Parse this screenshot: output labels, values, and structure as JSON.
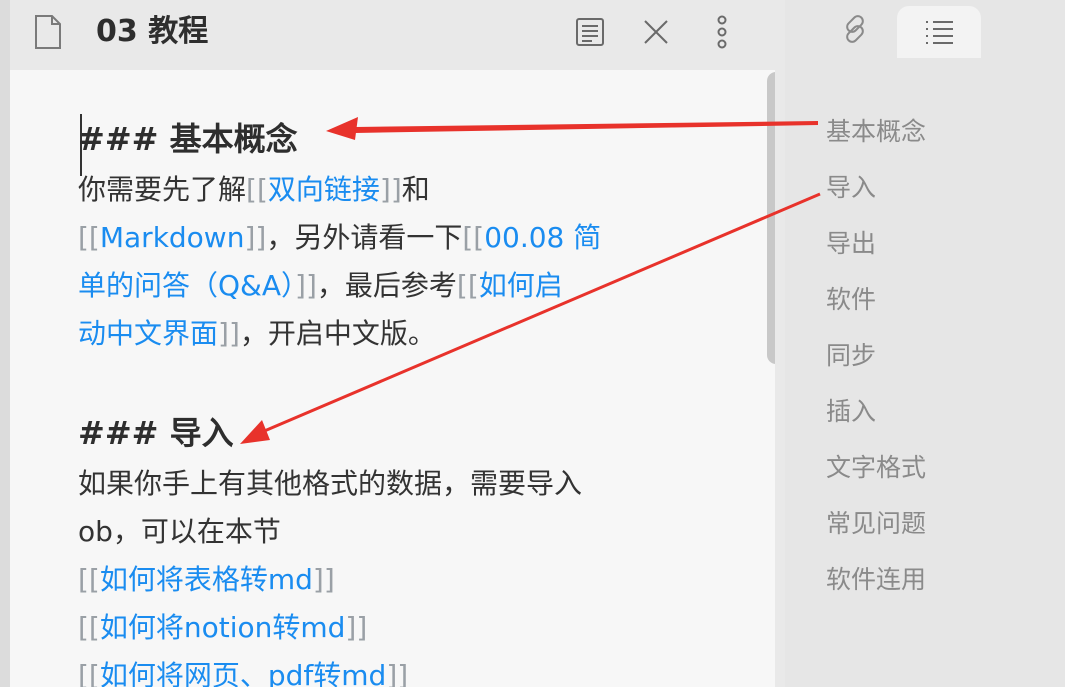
{
  "colors": {
    "link": "#1a8cf0",
    "bracket": "#9aa0a6",
    "text": "#2e2e2e",
    "outline_text": "#8a8a8a",
    "arrow": "#e8322b"
  },
  "header": {
    "file_icon": "file-icon",
    "title": "03 教程",
    "reading_icon": "reading-view-icon",
    "close_icon": "close-icon",
    "more_icon": "more-options-icon"
  },
  "content": {
    "h1": "### 基本概念",
    "p1": {
      "t1": "你需要先了解",
      "lb": "[[",
      "rb": "]]",
      "link1": "双向链接",
      "t2": "和",
      "link2": "Markdown",
      "t3": "，另外请看一下",
      "link3a": "00.08 简",
      "link3b": "单的问答（Q&A）",
      "t4": "，最后参考",
      "link4a": "如何启",
      "link4b": "动中文界面",
      "t5": "，开启中文版。"
    },
    "h2": "### 导入",
    "p2": {
      "t1": "如果你手上有其他格式的数据，需要导入",
      "t2": "ob，可以在本节",
      "link1": "如何将表格转md",
      "link2": "如何将notion转md",
      "link3": "如何将网页、pdf转md"
    }
  },
  "right_tabs": {
    "links_icon": "link-icon",
    "outline_icon": "outline-list-icon"
  },
  "outline": [
    "基本概念",
    "导入",
    "导出",
    "软件",
    "同步",
    "插入",
    "文字格式",
    "常见问题",
    "软件连用"
  ]
}
